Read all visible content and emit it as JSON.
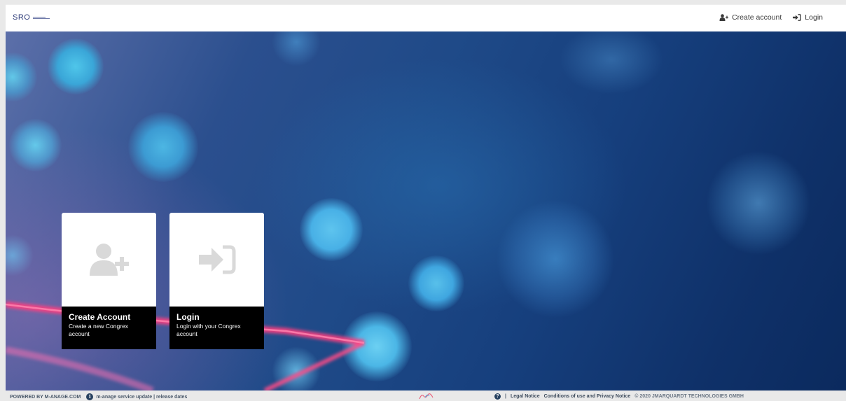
{
  "header": {
    "logo_text": "SRO",
    "create_account_label": "Create account",
    "login_label": "Login"
  },
  "cards": [
    {
      "title": "Create Account",
      "description": "Create a new Congrex account",
      "icon": "user-plus-icon"
    },
    {
      "title": "Login",
      "description": "Login with your Congrex account",
      "icon": "sign-in-icon"
    }
  ],
  "footer": {
    "powered_by": "POWERED BY M-ANAGE.COM",
    "service_update": "m-anage service update | release dates",
    "separator": "|",
    "legal_notice": "Legal Notice",
    "conditions": "Conditions of use and Privacy Notice",
    "copyright": "© 2020 JMARQUARDT TECHNOLOGIES GMBH"
  },
  "colors": {
    "topbar": "#ffffff",
    "hero_dark": "#0f3169",
    "card_caption": "#000000",
    "card_icon": "#d8d8d8",
    "accent_pink": "#ff3d7f"
  }
}
